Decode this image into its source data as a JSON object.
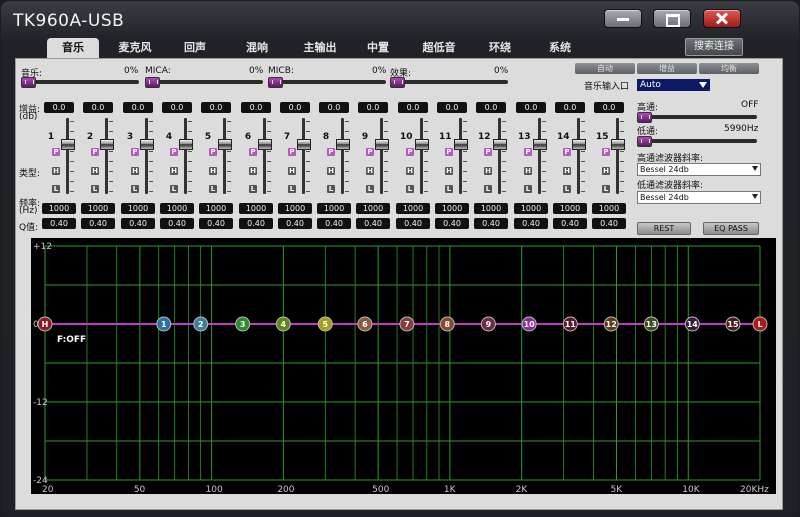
{
  "window": {
    "title": "TK960A-USB"
  },
  "tabs": [
    {
      "label": "音乐"
    },
    {
      "label": "麦克风"
    },
    {
      "label": "回声"
    },
    {
      "label": "混响"
    },
    {
      "label": "主输出"
    },
    {
      "label": "中置"
    },
    {
      "label": "超低音"
    },
    {
      "label": "环绕"
    },
    {
      "label": "系统"
    }
  ],
  "search_button": "搜索连接",
  "mix": [
    {
      "label": "音乐:",
      "value": "0%"
    },
    {
      "label": "MICA:",
      "value": "0%"
    },
    {
      "label": "MICB:",
      "value": "0%"
    },
    {
      "label": "效果:",
      "value": "0%"
    }
  ],
  "mode_buttons": [
    "自动",
    "增益",
    "均衡"
  ],
  "input": {
    "label": "音乐输入口",
    "value": "Auto"
  },
  "labels": {
    "gain": "增益:",
    "gain_unit": "(db)",
    "type": "类型:",
    "freq": "频率:",
    "freq_unit": "(Hz)",
    "q": "Q值:"
  },
  "bands": [
    {
      "num": "1",
      "gain": "0.0",
      "freq": "1000",
      "q": "0.40"
    },
    {
      "num": "2",
      "gain": "0.0",
      "freq": "1000",
      "q": "0.40"
    },
    {
      "num": "3",
      "gain": "0.0",
      "freq": "1000",
      "q": "0.40"
    },
    {
      "num": "4",
      "gain": "0.0",
      "freq": "1000",
      "q": "0.40"
    },
    {
      "num": "5",
      "gain": "0.0",
      "freq": "1000",
      "q": "0.40"
    },
    {
      "num": "6",
      "gain": "0.0",
      "freq": "1000",
      "q": "0.40"
    },
    {
      "num": "7",
      "gain": "0.0",
      "freq": "1000",
      "q": "0.40"
    },
    {
      "num": "8",
      "gain": "0.0",
      "freq": "1000",
      "q": "0.40"
    },
    {
      "num": "9",
      "gain": "0.0",
      "freq": "1000",
      "q": "0.40"
    },
    {
      "num": "10",
      "gain": "0.0",
      "freq": "1000",
      "q": "0.40"
    },
    {
      "num": "11",
      "gain": "0.0",
      "freq": "1000",
      "q": "0.40"
    },
    {
      "num": "12",
      "gain": "0.0",
      "freq": "1000",
      "q": "0.40"
    },
    {
      "num": "13",
      "gain": "0.0",
      "freq": "1000",
      "q": "0.40"
    },
    {
      "num": "14",
      "gain": "0.0",
      "freq": "1000",
      "q": "0.40"
    },
    {
      "num": "15",
      "gain": "0.0",
      "freq": "1000",
      "q": "0.40"
    }
  ],
  "type_letters": {
    "p": "P",
    "h": "H",
    "l": "L"
  },
  "highpass": {
    "label": "高通:",
    "value": "OFF",
    "slope_label": "高通滤波器斜率:",
    "slope": "Bessel 24db"
  },
  "lowpass": {
    "label": "低通:",
    "value": "5990Hz",
    "slope_label": "低通滤波器斜率:",
    "slope": "Bessel 24db"
  },
  "buttons": {
    "rest": "REST",
    "eqpass": "EQ PASS"
  },
  "chart_data": {
    "type": "line",
    "xscale": "log",
    "xlim": [
      20,
      20000
    ],
    "ylim": [
      -24,
      12
    ],
    "y_ticks": [
      "+12",
      "0",
      "-12",
      "-24"
    ],
    "x_ticks": [
      {
        "value": 20,
        "label": "20"
      },
      {
        "value": 50,
        "label": "50"
      },
      {
        "value": 100,
        "label": "100"
      },
      {
        "value": 200,
        "label": "200"
      },
      {
        "value": 500,
        "label": "500"
      },
      {
        "value": 1000,
        "label": "1K"
      },
      {
        "value": 2000,
        "label": "2K"
      },
      {
        "value": 5000,
        "label": "5K"
      },
      {
        "value": 10000,
        "label": "10K"
      },
      {
        "value": 20000,
        "label": "20KHz"
      }
    ],
    "grid_minor_x": [
      30,
      40,
      60,
      70,
      80,
      90,
      300,
      400,
      600,
      700,
      800,
      900,
      3000,
      4000,
      6000,
      7000,
      8000,
      9000
    ],
    "grid_y": [
      12,
      6,
      0,
      -6,
      -12,
      -18,
      -24
    ],
    "status": "F:OFF",
    "markers": [
      {
        "label": "H",
        "freq": 20,
        "gain": 0,
        "color": "#8b1a1a"
      },
      {
        "label": "1",
        "freq": 63,
        "gain": 0,
        "color": "#2a6fa8"
      },
      {
        "label": "2",
        "freq": 90,
        "gain": 0,
        "color": "#3f7e9a"
      },
      {
        "label": "3",
        "freq": 135,
        "gain": 0,
        "color": "#2a8a2a"
      },
      {
        "label": "4",
        "freq": 200,
        "gain": 0,
        "color": "#5a8a1a"
      },
      {
        "label": "5",
        "freq": 300,
        "gain": 0,
        "color": "#a6a016"
      },
      {
        "label": "6",
        "freq": 440,
        "gain": 0,
        "color": "#8a5a3a"
      },
      {
        "label": "7",
        "freq": 660,
        "gain": 0,
        "color": "#8a3a3a"
      },
      {
        "label": "8",
        "freq": 975,
        "gain": 0,
        "color": "#8a4a2a"
      },
      {
        "label": "9",
        "freq": 1450,
        "gain": 0,
        "color": "#6a2a4a"
      },
      {
        "label": "10",
        "freq": 2150,
        "gain": 0,
        "color": "#8a2a9a"
      },
      {
        "label": "11",
        "freq": 3200,
        "gain": 0,
        "color": "#5a1a2a"
      },
      {
        "label": "12",
        "freq": 4750,
        "gain": 0,
        "color": "#5a3a1a"
      },
      {
        "label": "13",
        "freq": 7000,
        "gain": 0,
        "color": "#3a4a1a"
      },
      {
        "label": "14",
        "freq": 10400,
        "gain": 0,
        "color": "#3a1a3a"
      },
      {
        "label": "15",
        "freq": 15400,
        "gain": 0,
        "color": "#4a1a1a"
      },
      {
        "label": "L",
        "freq": 20000,
        "gain": 0,
        "color": "#b01818"
      }
    ],
    "line_color": "#c23bc8",
    "grid_color": "#2f9a2f"
  }
}
